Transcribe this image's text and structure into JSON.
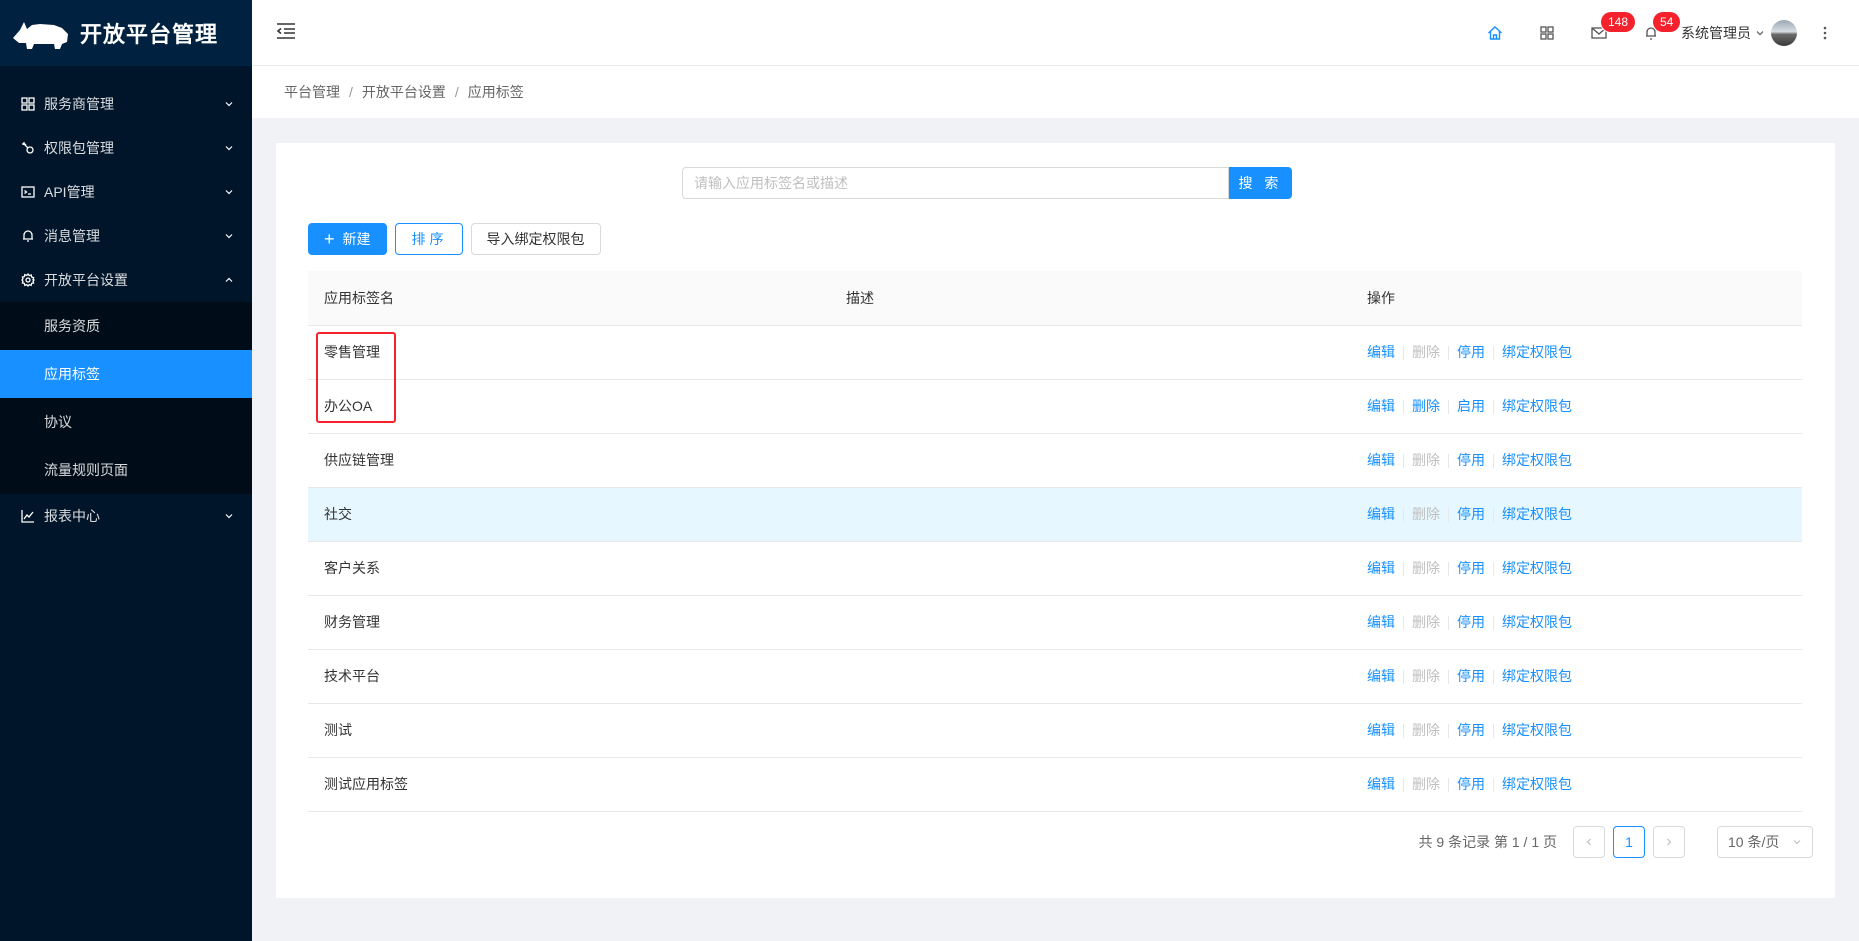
{
  "app": {
    "title": "开放平台管理"
  },
  "sidebar": {
    "items": [
      {
        "label": "服务商管理",
        "icon": "appstore-icon",
        "expanded": false
      },
      {
        "label": "权限包管理",
        "icon": "key-icon",
        "expanded": false
      },
      {
        "label": "API管理",
        "icon": "api-icon",
        "expanded": false
      },
      {
        "label": "消息管理",
        "icon": "bell-icon",
        "expanded": false
      },
      {
        "label": "开放平台设置",
        "icon": "setting-icon",
        "expanded": true
      },
      {
        "label": "报表中心",
        "icon": "line-chart-icon",
        "expanded": false
      }
    ],
    "submenu": [
      {
        "label": "服务资质",
        "active": false
      },
      {
        "label": "应用标签",
        "active": true
      },
      {
        "label": "协议",
        "active": false
      },
      {
        "label": "流量规则页面",
        "active": false
      }
    ]
  },
  "header": {
    "mail_badge": "148",
    "notice_badge": "54",
    "user_name": "系统管理员"
  },
  "breadcrumb": [
    "平台管理",
    "开放平台设置",
    "应用标签"
  ],
  "search": {
    "placeholder": "请输入应用标签名或描述",
    "button": "搜 索",
    "value": ""
  },
  "toolbar": {
    "new_label": "新建",
    "sort_label": "排序",
    "import_label": "导入绑定权限包"
  },
  "table": {
    "headers": {
      "name": "应用标签名",
      "desc": "描述",
      "actions": "操作"
    },
    "rows": [
      {
        "name": "零售管理",
        "desc": "",
        "toggle": "停用",
        "delete_enabled": false
      },
      {
        "name": "办公OA",
        "desc": "",
        "toggle": "启用",
        "delete_enabled": true
      },
      {
        "name": "供应链管理",
        "desc": "",
        "toggle": "停用",
        "delete_enabled": false
      },
      {
        "name": "社交",
        "desc": "",
        "toggle": "停用",
        "delete_enabled": false
      },
      {
        "name": "客户关系",
        "desc": "",
        "toggle": "停用",
        "delete_enabled": false
      },
      {
        "name": "财务管理",
        "desc": "",
        "toggle": "停用",
        "delete_enabled": false
      },
      {
        "name": "技术平台",
        "desc": "",
        "toggle": "停用",
        "delete_enabled": false
      },
      {
        "name": "测试",
        "desc": "",
        "toggle": "停用",
        "delete_enabled": false
      },
      {
        "name": "测试应用标签",
        "desc": "",
        "toggle": "停用",
        "delete_enabled": false
      }
    ],
    "action_labels": {
      "edit": "编辑",
      "delete": "删除",
      "bind": "绑定权限包"
    }
  },
  "pagination": {
    "summary": "共 9 条记录 第 1 / 1 页",
    "current": "1",
    "page_size": "10 条/页"
  },
  "colors": {
    "primary": "#1890ff",
    "sidebar_bg": "#001529",
    "badge": "#f5222d",
    "highlight": "#f5222d"
  }
}
